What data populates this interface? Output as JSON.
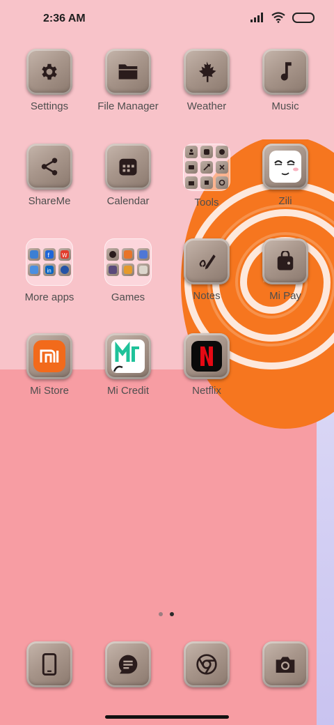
{
  "status_bar": {
    "time": "2:36 AM",
    "icons": [
      "signal-icon",
      "wifi-icon",
      "battery-icon"
    ]
  },
  "apps": [
    {
      "label": "Settings",
      "icon": "gear-icon"
    },
    {
      "label": "File Manager",
      "icon": "folder-icon"
    },
    {
      "label": "Weather",
      "icon": "maple-leaf-icon"
    },
    {
      "label": "Music",
      "icon": "music-note-icon"
    },
    {
      "label": "ShareMe",
      "icon": "share-icon"
    },
    {
      "label": "Calendar",
      "icon": "calendar-icon"
    },
    {
      "label": "Tools",
      "icon": "tools-folder"
    },
    {
      "label": "Zili",
      "icon": "zili-face-icon"
    },
    {
      "label": "More apps",
      "icon": "more-apps-folder"
    },
    {
      "label": "Games",
      "icon": "games-folder"
    },
    {
      "label": "Notes",
      "icon": "notes-pen-icon"
    },
    {
      "label": "Mi Pay",
      "icon": "wallet-icon"
    },
    {
      "label": "Mi Store",
      "icon": "mi-store-icon"
    },
    {
      "label": "Mi Credit",
      "icon": "mi-credit-icon"
    },
    {
      "label": "Netflix",
      "icon": "netflix-icon"
    }
  ],
  "page_indicator": {
    "pages": 2,
    "current": 2
  },
  "dock": [
    {
      "icon": "phone-icon"
    },
    {
      "icon": "messages-icon"
    },
    {
      "icon": "browser-icon"
    },
    {
      "icon": "camera-icon"
    }
  ],
  "colors": {
    "wallpaper_top": "#f8c3c9",
    "wallpaper_bottom": "#f79da3",
    "lollipop_orange": "#f5721e",
    "icon_glyph": "#2a1c1c"
  }
}
